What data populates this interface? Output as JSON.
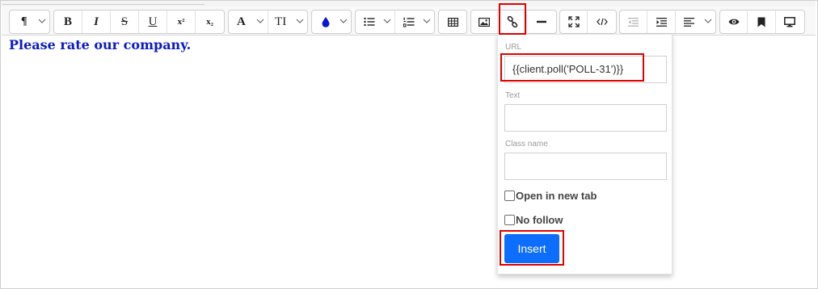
{
  "editor": {
    "content_text": "Please rate our company."
  },
  "toolbar": {
    "buttons": [
      {
        "name": "paragraph-format",
        "icon": "pilcrow-icon",
        "label": "¶"
      },
      {
        "name": "bold",
        "icon": "bold-icon",
        "label": "B"
      },
      {
        "name": "italic",
        "icon": "italic-icon",
        "label": "I"
      },
      {
        "name": "strikethrough",
        "icon": "strikethrough-icon",
        "label": "S"
      },
      {
        "name": "underline",
        "icon": "underline-icon",
        "label": "U"
      },
      {
        "name": "superscript",
        "icon": "superscript-icon",
        "label": "x²"
      },
      {
        "name": "subscript",
        "icon": "subscript-icon",
        "label": "x₂"
      },
      {
        "name": "font-family",
        "icon": "font-icon",
        "label": "A"
      },
      {
        "name": "font-size",
        "icon": "text-height-icon",
        "label": "TI"
      },
      {
        "name": "text-color",
        "icon": "droplet-icon"
      },
      {
        "name": "unordered-list",
        "icon": "bullet-list-icon"
      },
      {
        "name": "ordered-list",
        "icon": "numbered-list-icon"
      },
      {
        "name": "table",
        "icon": "table-icon"
      },
      {
        "name": "image",
        "icon": "image-icon"
      },
      {
        "name": "link",
        "icon": "link-icon"
      },
      {
        "name": "horizontal-rule",
        "icon": "minus-icon"
      },
      {
        "name": "fullscreen",
        "icon": "expand-icon"
      },
      {
        "name": "code-view",
        "icon": "code-icon"
      },
      {
        "name": "outdent",
        "icon": "outdent-icon"
      },
      {
        "name": "indent",
        "icon": "indent-icon"
      },
      {
        "name": "align",
        "icon": "align-left-icon"
      },
      {
        "name": "preview",
        "icon": "eye-icon"
      },
      {
        "name": "bookmark",
        "icon": "bookmark-icon"
      },
      {
        "name": "desktop-preview",
        "icon": "desktop-icon"
      }
    ]
  },
  "link_popup": {
    "url_label": "URL",
    "url_value": "{{client.poll('POLL-31')}}",
    "text_label": "Text",
    "text_value": "",
    "class_label": "Class name",
    "class_value": "",
    "open_new_tab_label": "Open in new tab",
    "open_new_tab_checked": false,
    "no_follow_label": "No follow",
    "no_follow_checked": false,
    "insert_label": "Insert"
  },
  "colors": {
    "content_text": "#0a19c9",
    "insert_button": "#0d6efd",
    "highlight": "#e00000",
    "text_color_icon": "#0a19c9"
  }
}
